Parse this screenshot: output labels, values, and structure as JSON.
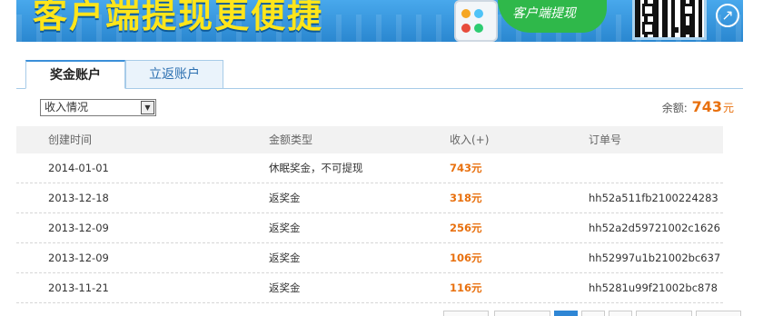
{
  "banner": {
    "headline": "客户端提现更便捷",
    "bubble_text": "客户端提现"
  },
  "tabs": [
    {
      "label": "奖金账户",
      "active": true
    },
    {
      "label": "立返账户",
      "active": false
    }
  ],
  "filter": {
    "selected": "收入情况"
  },
  "balance": {
    "label": "余额:",
    "value": "743",
    "unit": "元"
  },
  "table": {
    "headers": [
      "创建时间",
      "金额类型",
      "收入(+)",
      "订单号"
    ],
    "rows": [
      {
        "date": "2014-01-01",
        "type": "休眠奖金，不可提现",
        "amount": "743元",
        "order": ""
      },
      {
        "date": "2013-12-18",
        "type": "返奖金",
        "amount": "318元",
        "order": "hh52a511fb2100224283"
      },
      {
        "date": "2013-12-09",
        "type": "返奖金",
        "amount": "256元",
        "order": "hh52a2d59721002c1626"
      },
      {
        "date": "2013-12-09",
        "type": "返奖金",
        "amount": "106元",
        "order": "hh52997u1b21002bc637"
      },
      {
        "date": "2013-11-21",
        "type": "返奖金",
        "amount": "116元",
        "order": "hh5281u99f21002bc878"
      }
    ]
  },
  "colors": {
    "accent_orange": "#e8700e",
    "tab_border": "#a7cbe8",
    "banner_blue": "#2b8fd6",
    "headline_yellow": "#ffe51a"
  }
}
